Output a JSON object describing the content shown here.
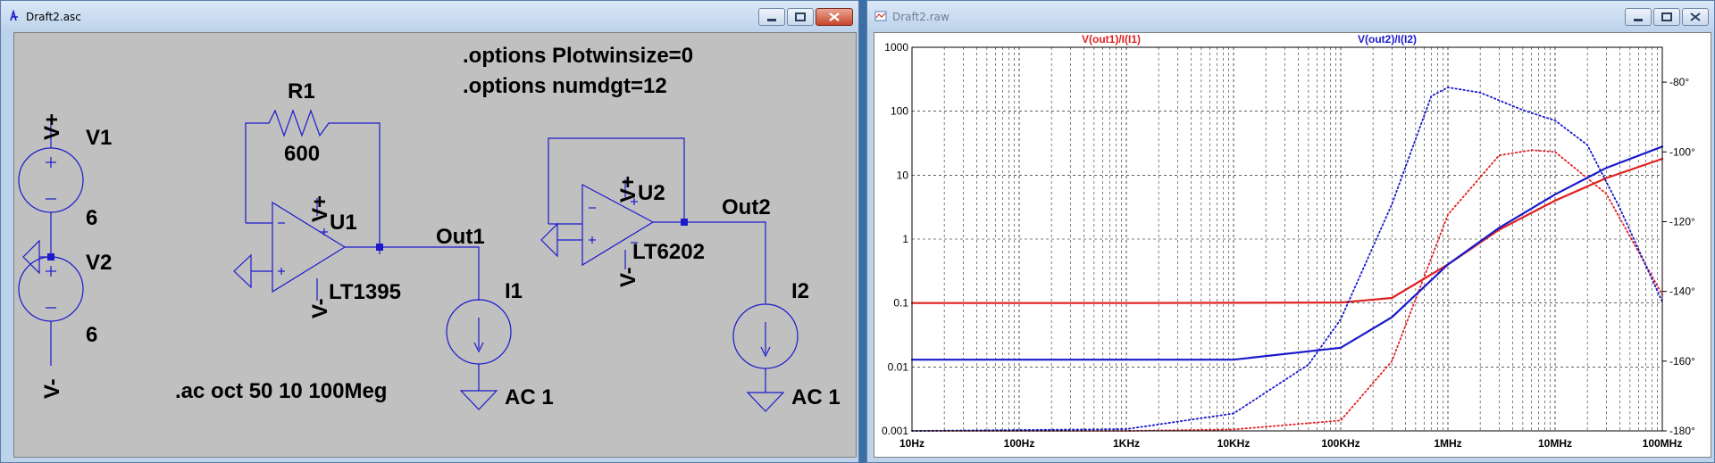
{
  "left_window": {
    "title": "Draft2.asc",
    "directives": [
      ".options Plotwinsize=0",
      ".options numdgt=12",
      ".ac oct 50 10 100Meg"
    ],
    "components": {
      "v1": {
        "name": "V1",
        "value": "6"
      },
      "v2": {
        "name": "V2",
        "value": "6"
      },
      "vplus": "V+",
      "vminus": "V-",
      "r1": {
        "name": "R1",
        "value": "600"
      },
      "u1": {
        "name": "U1",
        "model": "LT1395"
      },
      "u2": {
        "name": "U2",
        "model": "LT6202"
      },
      "i1": {
        "name": "I1",
        "value": "AC 1"
      },
      "i2": {
        "name": "I2",
        "value": "AC 1"
      },
      "net_out1": "Out1",
      "net_out2": "Out2"
    },
    "colors": {
      "wire": "#1a1acc",
      "component": "#1a1acc",
      "text": "#000000",
      "background": "#c0c0c0"
    }
  },
  "right_window": {
    "title": "Draft2.raw",
    "chart_data": {
      "type": "line",
      "x_scale": "log",
      "xlim": [
        10,
        100000000
      ],
      "x_ticks": [
        "10Hz",
        "100Hz",
        "1KHz",
        "10KHz",
        "100KHz",
        "1MHz",
        "10MHz",
        "100MHz"
      ],
      "y_scale": "log",
      "ylim": [
        0.001,
        1000
      ],
      "y_ticks": [
        "0.001",
        "0.01",
        "0.1",
        "1",
        "10",
        "100",
        "1000"
      ],
      "y2lim": [
        -180,
        -70
      ],
      "y2_ticks": [
        "-80°",
        "-100°",
        "-120°",
        "-140°",
        "-160°",
        "-180°"
      ],
      "grid": true,
      "series": [
        {
          "name": "V(out1)/I(I1)",
          "color": "#e02020",
          "style": "solid",
          "x": [
            10,
            1000,
            100000,
            300000,
            1000000,
            3000000,
            10000000,
            30000000,
            100000000
          ],
          "values": [
            0.1,
            0.1,
            0.102,
            0.12,
            0.4,
            1.4,
            4,
            9,
            18
          ]
        },
        {
          "name": "V(out1)/I(I1) phase",
          "color": "#e02020",
          "style": "dotted",
          "x": [
            10,
            1000,
            10000,
            100000,
            300000,
            1000000,
            3000000,
            6000000,
            10000000,
            30000000,
            100000000
          ],
          "values": [
            -180,
            -180,
            -179.6,
            -177,
            -160,
            -118,
            -101,
            -99.5,
            -100,
            -112,
            -141
          ]
        },
        {
          "name": "V(out2)/I(I2)",
          "color": "#1a1acc",
          "style": "solid",
          "x": [
            10,
            10000,
            100000,
            300000,
            1000000,
            3000000,
            10000000,
            30000000,
            100000000
          ],
          "values": [
            0.013,
            0.013,
            0.02,
            0.06,
            0.4,
            1.5,
            5,
            13,
            28
          ]
        },
        {
          "name": "V(out2)/I(I2) phase",
          "color": "#1a1acc",
          "style": "dotted",
          "x": [
            10,
            1000,
            10000,
            50000,
            100000,
            300000,
            700000,
            1000000,
            2000000,
            5000000,
            10000000,
            20000000,
            40000000,
            100000000
          ],
          "values": [
            -180,
            -179.5,
            -175,
            -161,
            -148,
            -115,
            -84,
            -81.5,
            -83,
            -88,
            -91,
            -98,
            -116,
            -143
          ]
        }
      ]
    }
  }
}
